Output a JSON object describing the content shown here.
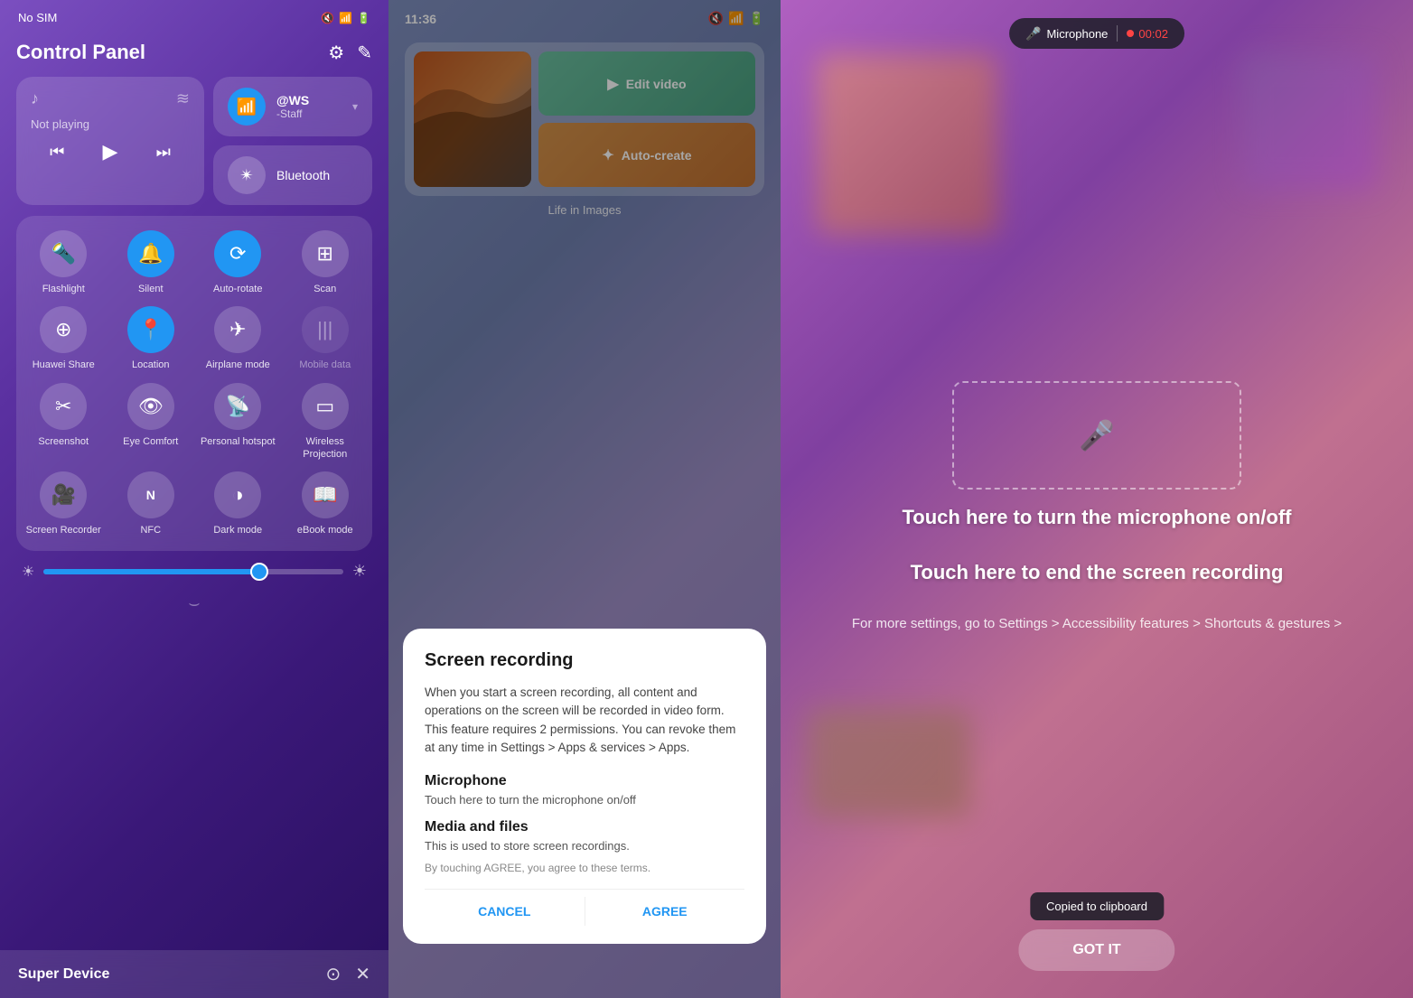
{
  "panel1": {
    "status": {
      "carrier": "No SIM",
      "icons": "🔇📶🔋"
    },
    "title": "Control Panel",
    "header_icons": {
      "settings": "⚙",
      "edit": "✎"
    },
    "media": {
      "not_playing": "Not playing",
      "icon_music": "♪",
      "icon_wave": "〜"
    },
    "wifi": {
      "name": "@WS",
      "sub": "-Staff",
      "arrow": "▾"
    },
    "bluetooth": {
      "label": "Bluetooth"
    },
    "toggles": [
      {
        "label": "Flashlight",
        "icon": "🔦",
        "active": false
      },
      {
        "label": "Silent",
        "icon": "🔔",
        "active": true
      },
      {
        "label": "Auto-rotate",
        "icon": "⟳",
        "active": true
      },
      {
        "label": "Scan",
        "icon": "⊞",
        "active": false
      },
      {
        "label": "Huawei Share",
        "icon": "((·))",
        "active": false
      },
      {
        "label": "Location",
        "icon": "📍",
        "active": true
      },
      {
        "label": "Airplane mode",
        "icon": "✈",
        "active": false
      },
      {
        "label": "Mobile data",
        "icon": "|||",
        "active": false,
        "dimmed": true
      },
      {
        "label": "Screenshot",
        "icon": "✂",
        "active": false
      },
      {
        "label": "Eye Comfort",
        "icon": "👁",
        "active": false
      },
      {
        "label": "Personal hotspot",
        "icon": "📡",
        "active": false
      },
      {
        "label": "Wireless Projection",
        "icon": "▭",
        "active": false
      }
    ],
    "extra_toggles": [
      {
        "label": "Screen Recorder",
        "icon": "🎥",
        "active": false
      },
      {
        "label": "NFC",
        "icon": "N",
        "active": false
      },
      {
        "label": "Dark mode",
        "icon": "◑",
        "active": false
      },
      {
        "label": "eBook mode",
        "icon": "📖",
        "active": false
      }
    ],
    "brightness": {
      "percent": 72
    },
    "super_device": {
      "label": "Super Device"
    }
  },
  "panel2": {
    "status": {
      "time": "11:36",
      "icons": "🔇📶🔋"
    },
    "photo_album": {
      "title": "Life in Images"
    },
    "edit_video": "Edit video",
    "auto_create": "Auto-create",
    "dialog": {
      "title": "Screen recording",
      "body": "When you start a screen recording, all content and operations on the screen will be recorded in video form. This feature requires 2 permissions. You can revoke them at any time in Settings > Apps & services > Apps.",
      "mic_title": "Microphone",
      "mic_desc": "Touch here to turn the microphone on/off",
      "media_title": "Media and files",
      "media_desc": "This is used to store screen recordings.",
      "agree_text": "By touching AGREE, you agree to these terms.",
      "cancel": "CANCEL",
      "agree": "AGREE"
    }
  },
  "panel3": {
    "mic_label": "Microphone",
    "rec_time": "00:02",
    "instruction_mic": "Touch here to turn the\nmicrophone on/off",
    "instruction_end": "Touch here to end the screen\nrecording",
    "settings_text": "For more settings, go to Settings > Accessibility\nfeatures > Shortcuts & gestures >",
    "got_it": "GOT IT",
    "clipboard_toast": "Copied to clipboard"
  }
}
